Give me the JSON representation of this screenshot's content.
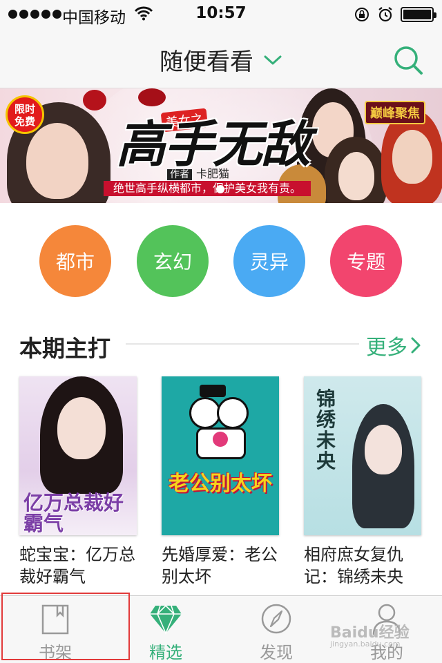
{
  "status_bar": {
    "carrier": "中国移动",
    "time": "10:57",
    "battery_level": 1.0,
    "icons": [
      "signal-dots-icon",
      "wifi-icon",
      "orientation-lock-icon",
      "alarm-icon",
      "battery-icon"
    ]
  },
  "nav": {
    "title": "随便看看",
    "dropdown_icon": "chevron-down-icon",
    "search_icon": "search-icon"
  },
  "banner": {
    "badge": "限时免费",
    "sub_title": "美女之",
    "headline": "高手无敌",
    "author_tag": "作者",
    "author": "卡肥猫",
    "tagline": "绝世高手纵横都市，保护美女我有责。",
    "publisher_logo": "巅峰聚焦"
  },
  "categories": [
    {
      "label": "都市",
      "color": "#f5873a"
    },
    {
      "label": "玄幻",
      "color": "#53c35a"
    },
    {
      "label": "灵异",
      "color": "#4aaaf3"
    },
    {
      "label": "专题",
      "color": "#f2456e"
    }
  ],
  "section": {
    "title": "本期主打",
    "more_label": "更多",
    "more_icon": "chevron-right-icon"
  },
  "books": [
    {
      "title": "蛇宝宝：亿万总裁好霸气",
      "cover_text": "亿万总裁好霸气"
    },
    {
      "title": "先婚厚爱：老公别太坏",
      "cover_text": "老公别太坏"
    },
    {
      "title": "相府庶女复仇记：锦绣未央",
      "cover_text": "锦绣未央"
    }
  ],
  "tabs": [
    {
      "label": "书架",
      "icon": "bookshelf-icon",
      "active": false
    },
    {
      "label": "精选",
      "icon": "diamond-icon",
      "active": true
    },
    {
      "label": "发现",
      "icon": "compass-icon",
      "active": false
    },
    {
      "label": "我的",
      "icon": "user-icon",
      "active": false
    }
  ],
  "colors": {
    "accent": "#35b07a",
    "text_primary": "#222222",
    "tab_inactive": "#999999",
    "highlight_box": "#e23a3a"
  },
  "watermark": {
    "brand": "Baidu经验",
    "url": "jingyan.baidu.com"
  }
}
